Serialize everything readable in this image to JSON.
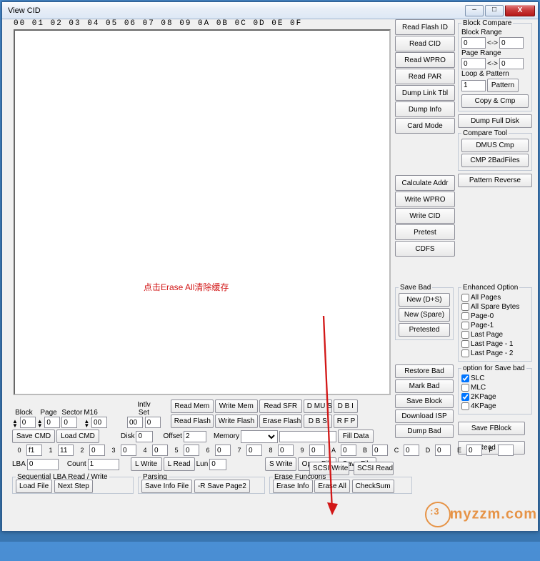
{
  "window": {
    "title": "View CID",
    "close": "X",
    "min": "–",
    "max": "□"
  },
  "hex_header": "00  01  02  03  04  05  06  07  08  09  0A 0B  0C 0D  0E  0F",
  "overlay_note": "点击Erase All清除缓存",
  "btns_right_col1": [
    "Read Flash ID",
    "Read CID",
    "Read WPRO",
    "Read PAR",
    "Dump Link Tbl",
    "Dump Info",
    "Card Mode"
  ],
  "btns_right_col1b": [
    "Calculate Addr",
    "Write WPRO",
    "Write CID",
    "Pretest",
    "CDFS"
  ],
  "block_compare": {
    "legend": "Block Compare",
    "label_range": "Block Range",
    "r1": "0",
    "r2": "0",
    "arrow": "<->",
    "label_page": "Page Range",
    "p1": "0",
    "p2": "0",
    "label_loop": "Loop & Pattern",
    "loop": "1",
    "btn_pattern": "Pattern",
    "btn_copy": "Copy & Cmp"
  },
  "dump_full": "Dump Full Disk",
  "compare_tool": {
    "legend": "Compare Tool",
    "b1": "DMUS Cmp",
    "b2": "CMP 2BadFiles"
  },
  "pattern_reverse": "Pattern Reverse",
  "save_bad": {
    "legend": "Save Bad",
    "b1": "New (D+S)",
    "b2": "New (Spare)",
    "b3": "Pretested"
  },
  "enhanced": {
    "legend": "Enhanced Option",
    "items": [
      "All Pages",
      "All Spare Bytes",
      "Page-0",
      "Page-1",
      "Last Page",
      "Last Page - 1",
      "Last Page - 2"
    ]
  },
  "restore_bad": "Restore Bad",
  "mark_bad": "Mark Bad",
  "save_block": "Save Block",
  "download_isp": "Download ISP",
  "save_fblock": "Save FBlock",
  "dump_bad": "Dump Bad",
  "read_w": "Read W",
  "opt_save": {
    "legend": "option for Save bad",
    "items": [
      [
        "SLC",
        true
      ],
      [
        "MLC",
        false
      ],
      [
        "2KPage",
        true
      ],
      [
        "4KPage",
        false
      ]
    ]
  },
  "low": {
    "labels1": {
      "Block": "Block",
      "Page": "Page",
      "Sector": "Sector",
      "M16": "M16",
      "Intlv": "Intlv\nSet"
    },
    "block_up": "",
    "block_down": "",
    "block": "0",
    "page_up": "",
    "page_down": "",
    "page": "0",
    "sector": "0",
    "m16": "00",
    "intlv": "00",
    "intlv2": "0",
    "read_mem": "Read Mem",
    "write_mem": "Write Mem",
    "read_sfr": "Read SFR",
    "read_flash": "Read Flash",
    "write_flash": "Write Flash",
    "erase_flash": "Erase Flash",
    "dmus": "D MU S",
    "dbi": "D B I",
    "dbs": "D B S",
    "rfp": "R F P",
    "save_cmd": "Save CMD",
    "load_cmd": "Load CMD",
    "disk_lbl": "Disk",
    "disk": "0",
    "offset_lbl": "Offset",
    "offset": "2",
    "memory_lbl": "Memory",
    "memory": "",
    "fill_data": "Fill Data",
    "hex_labels": [
      "0",
      "1",
      "2",
      "3",
      "4",
      "5",
      "6",
      "7",
      "8",
      "9",
      "A",
      "B",
      "C",
      "D",
      "E",
      "F"
    ],
    "hex_vals": [
      "f1",
      "11",
      "0",
      "0",
      "0",
      "0",
      "0",
      "0",
      "0",
      "0",
      "0",
      "0",
      "0",
      "0",
      "0",
      ""
    ],
    "scsi_write": "SCSI Write",
    "scsi_read": "SCSI Read",
    "lba_lbl": "LBA",
    "lba": "0",
    "count_lbl": "Count",
    "count": "1",
    "lwrite": "L Write",
    "lread": "L Read",
    "lun_lbl": "Lun",
    "lun": "0",
    "swrite": "S Write",
    "open_file": "Open File",
    "save_file": "Save File",
    "seq": {
      "legend": "Sequential LBA Read / Write",
      "b1": "Load File",
      "b2": "Next Step"
    },
    "parsing": {
      "legend": "Parsing",
      "b1": "Save Info File",
      "b2": "-R Save Page2"
    },
    "erase": {
      "legend": "Erase Functions",
      "b1": "Erase Info",
      "b2": "Erase All",
      "b3": "CheckSum"
    }
  },
  "watermark": "myzzm.com"
}
